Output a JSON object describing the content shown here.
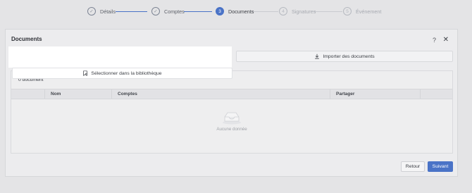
{
  "stepper": {
    "steps": [
      {
        "label": "Détails",
        "marker": "✓",
        "state": "done"
      },
      {
        "label": "Comptes",
        "marker": "✓",
        "state": "done"
      },
      {
        "label": "Documents",
        "marker": "3",
        "state": "active"
      },
      {
        "label": "Signatures",
        "marker": "4",
        "state": "todo"
      },
      {
        "label": "Événement",
        "marker": "5",
        "state": "todo"
      }
    ]
  },
  "modal": {
    "title": "Documents",
    "help_symbol": "?",
    "close_symbol": "✕"
  },
  "actions": {
    "select_label": "Sélectionner dans la bibliothèque",
    "import_label": "Importer des documents"
  },
  "documents": {
    "count_label": "0 document",
    "columns": [
      "",
      "Nom",
      "Comptes",
      "Partager",
      ""
    ],
    "empty_text": "Aucune donnée"
  },
  "footer": {
    "back_label": "Retour",
    "next_label": "Suivant"
  },
  "colors": {
    "accent": "#4a73c7",
    "background": "#e4e4e6"
  }
}
